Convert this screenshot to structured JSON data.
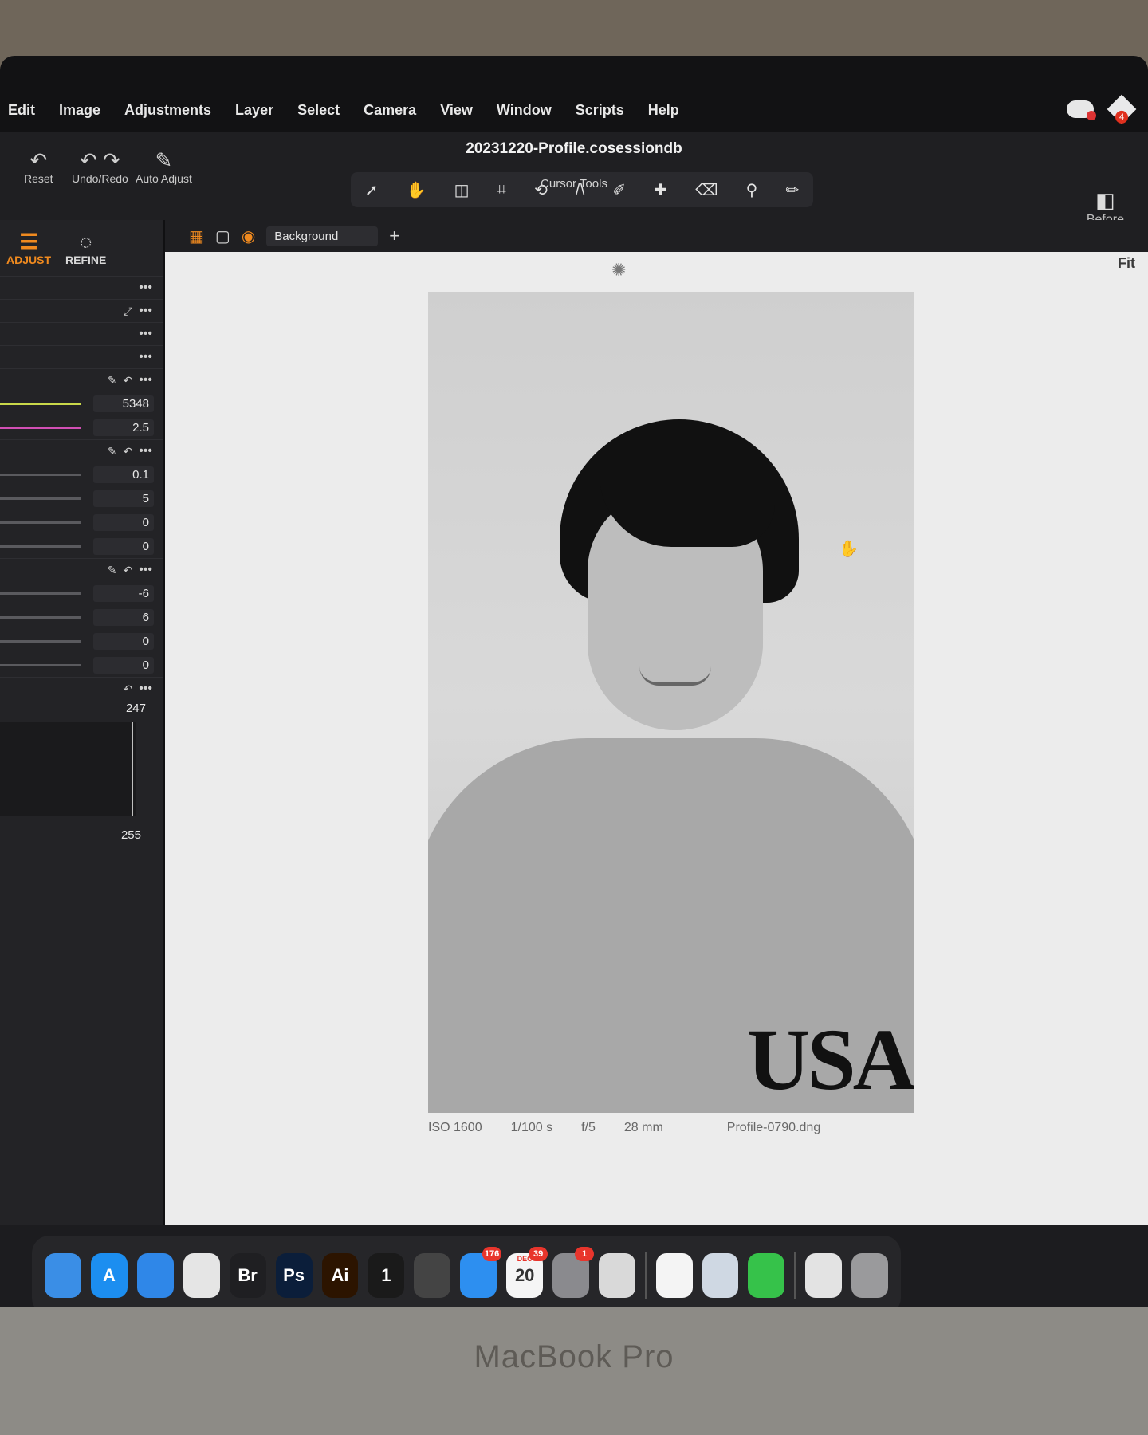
{
  "menubar": {
    "items": [
      "Edit",
      "Image",
      "Adjustments",
      "Layer",
      "Select",
      "Camera",
      "View",
      "Window",
      "Scripts",
      "Help"
    ]
  },
  "toolbar": {
    "reset_label": "Reset",
    "undo_redo_label": "Undo/Redo",
    "auto_adjust_label": "Auto Adjust",
    "document_title": "20231220-Profile.cosessiondb",
    "cursor_tools_label": "Cursor Tools",
    "before_label": "Before"
  },
  "left_panel": {
    "tabs": [
      {
        "label": "ADJUST",
        "active": true
      },
      {
        "label": "REFINE",
        "active": false
      }
    ],
    "white_balance": {
      "kelvin": "5348",
      "tint": "2.5"
    },
    "exposure_group": [
      "0.1",
      "5",
      "0",
      "0"
    ],
    "hdr_group": [
      "-6",
      "6",
      "0",
      "0"
    ],
    "levels": {
      "high": "247",
      "low": "255"
    }
  },
  "viewer": {
    "layer": "Background",
    "fit_label": "Fit",
    "shirt_text": "USA",
    "metadata": {
      "iso": "ISO 1600",
      "shutter": "1/100 s",
      "aperture": "f/5",
      "focal": "28 mm",
      "filename": "Profile-0790.dng"
    }
  },
  "dock": {
    "apps": [
      {
        "name": "Finder",
        "label": "",
        "color": "#3a8ee6"
      },
      {
        "name": "App Store",
        "label": "A",
        "color": "#1c8ef0"
      },
      {
        "name": "Safari",
        "label": "",
        "color": "#2f87e8"
      },
      {
        "name": "Chrome",
        "label": "",
        "color": "#e5e5e5"
      },
      {
        "name": "Bridge",
        "label": "Br",
        "color": "#1f1f22"
      },
      {
        "name": "Photoshop",
        "label": "Ps",
        "color": "#0b1e3a"
      },
      {
        "name": "Illustrator",
        "label": "Ai",
        "color": "#2c1400"
      },
      {
        "name": "Capture One",
        "label": "1",
        "color": "#1a1a1a"
      },
      {
        "name": "Final Cut Pro",
        "label": "",
        "color": "#444"
      },
      {
        "name": "Mail",
        "label": "",
        "color": "#2d8ff0",
        "badge": "176"
      },
      {
        "name": "Calendar",
        "label": "20",
        "color": "#f5f5f5",
        "badge": "39",
        "month": "DEC"
      },
      {
        "name": "System Settings",
        "label": "",
        "color": "#8a8a8e",
        "badge": "1"
      },
      {
        "name": "Launchpad",
        "label": "",
        "color": "#d9d9d9"
      },
      {
        "name": "Pages",
        "label": "",
        "color": "#f4f4f4"
      },
      {
        "name": "Preview",
        "label": "",
        "color": "#cfd8e3"
      },
      {
        "name": "FaceTime",
        "label": "",
        "color": "#36c24a"
      },
      {
        "name": "Archive",
        "label": "",
        "color": "#e3e3e3"
      },
      {
        "name": "Trash",
        "label": "",
        "color": "#9a9a9c"
      }
    ]
  },
  "hardware": {
    "label": "MacBook Pro"
  }
}
